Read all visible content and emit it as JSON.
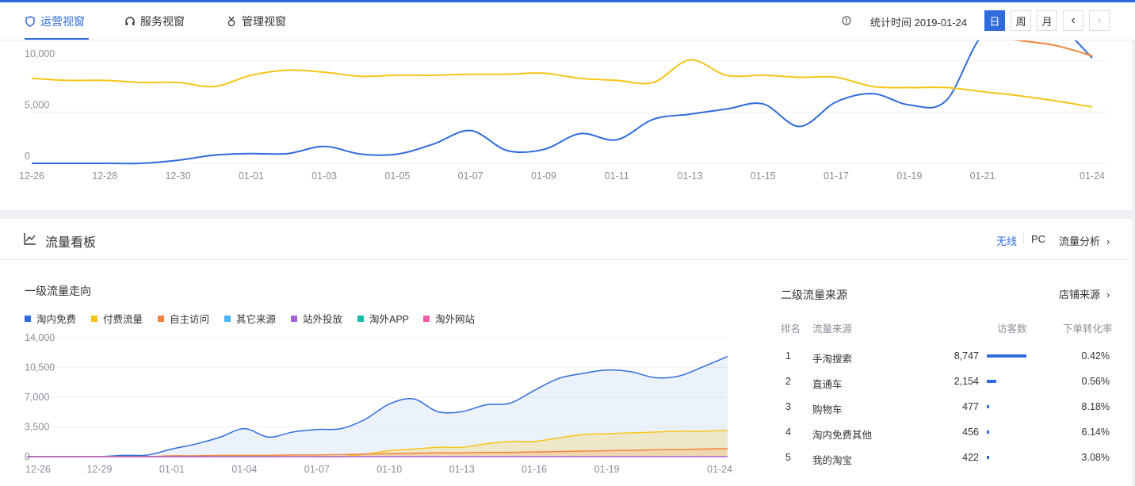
{
  "header": {
    "tabs": [
      {
        "label": "运营视窗",
        "active": true
      },
      {
        "label": "服务视窗",
        "active": false
      },
      {
        "label": "管理视窗",
        "active": false
      }
    ],
    "stat_time": "统计时间 2019-01-24",
    "period_buttons": [
      "日",
      "周",
      "月"
    ],
    "active_period": "日",
    "prev_label": "‹",
    "next_label": "›"
  },
  "top_chart": {
    "y_ticks": [
      "10,000",
      "5,000",
      "0"
    ],
    "x_ticks": [
      "12-26",
      "12-28",
      "12-30",
      "01-01",
      "01-03",
      "01-05",
      "01-07",
      "01-09",
      "01-11",
      "01-13",
      "01-15",
      "01-17",
      "01-19",
      "01-21",
      "01-24"
    ]
  },
  "panel": {
    "title": "流量看板",
    "modes": [
      "无线",
      "PC"
    ],
    "active_mode": "无线",
    "flow_link": "流量分析"
  },
  "level1": {
    "title": "一级流量走向",
    "legend": [
      {
        "name": "淘内免费",
        "color": "#2f6bdc"
      },
      {
        "name": "付费流量",
        "color": "#f5c518"
      },
      {
        "name": "自主访问",
        "color": "#f4843d"
      },
      {
        "name": "其它来源",
        "color": "#4db3f4"
      },
      {
        "name": "站外投放",
        "color": "#a862db"
      },
      {
        "name": "淘外APP",
        "color": "#17bfa8"
      },
      {
        "name": "淘外网站",
        "color": "#f05ea8"
      }
    ],
    "y_ticks": [
      "14,000",
      "10,500",
      "7,000",
      "3,500",
      "0"
    ],
    "x_ticks": [
      "12-26",
      "12-29",
      "01-01",
      "01-04",
      "01-07",
      "01-10",
      "01-13",
      "01-16",
      "01-19",
      "01-24"
    ]
  },
  "level2": {
    "title": "二级流量来源",
    "shop_source": "店铺来源",
    "headers": {
      "rank": "排名",
      "source": "流量来源",
      "visitors": "访客数",
      "conversion": "下单转化率"
    },
    "rows": [
      {
        "rank": "1",
        "source": "手淘搜索",
        "visitors": "8,747",
        "share": 1.0,
        "conversion": "0.42%"
      },
      {
        "rank": "2",
        "source": "直通车",
        "visitors": "2,154",
        "share": 0.246,
        "conversion": "0.56%"
      },
      {
        "rank": "3",
        "source": "购物车",
        "visitors": "477",
        "share": 0.055,
        "conversion": "8.18%"
      },
      {
        "rank": "4",
        "source": "淘内免费其他",
        "visitors": "456",
        "share": 0.052,
        "conversion": "6.14%"
      },
      {
        "rank": "5",
        "source": "我的淘宝",
        "visitors": "422",
        "share": 0.048,
        "conversion": "3.08%"
      }
    ]
  },
  "chart_data": [
    {
      "type": "line",
      "x": [
        "12-26",
        "12-27",
        "12-28",
        "12-29",
        "12-30",
        "12-31",
        "01-01",
        "01-02",
        "01-03",
        "01-04",
        "01-05",
        "01-06",
        "01-07",
        "01-08",
        "01-09",
        "01-10",
        "01-11",
        "01-12",
        "01-13",
        "01-14",
        "01-15",
        "01-16",
        "01-17",
        "01-18",
        "01-19",
        "01-20",
        "01-21",
        "01-22",
        "01-23",
        "01-24"
      ],
      "ylim": [
        0,
        12000
      ],
      "series": [
        {
          "color": "#2f6bdc",
          "values": [
            0,
            0,
            0,
            0,
            300,
            800,
            950,
            950,
            1650,
            900,
            900,
            1900,
            3200,
            1250,
            1350,
            2900,
            2300,
            4300,
            4800,
            5300,
            5800,
            3600,
            6000,
            6800,
            5700,
            6100,
            12500,
            12900,
            13500,
            10300
          ]
        },
        {
          "color": "#f5c518",
          "values": [
            8300,
            8100,
            8100,
            7900,
            7900,
            7500,
            8600,
            9100,
            8900,
            8500,
            8600,
            8600,
            8700,
            8700,
            8800,
            8300,
            8100,
            7900,
            10100,
            8600,
            8600,
            8400,
            8400,
            7500,
            7400,
            7400,
            7000,
            6600,
            6100,
            5500
          ]
        },
        {
          "color": "#f4843d",
          "values": [
            null,
            null,
            null,
            null,
            null,
            null,
            null,
            null,
            null,
            null,
            null,
            null,
            null,
            null,
            null,
            null,
            null,
            null,
            null,
            null,
            null,
            null,
            null,
            14000,
            13000,
            13000,
            12500,
            12000,
            11500,
            10500
          ]
        }
      ]
    },
    {
      "type": "area",
      "x": [
        "12-26",
        "12-27",
        "12-28",
        "12-29",
        "12-30",
        "12-31",
        "01-01",
        "01-02",
        "01-03",
        "01-04",
        "01-05",
        "01-06",
        "01-07",
        "01-08",
        "01-09",
        "01-10",
        "01-11",
        "01-12",
        "01-13",
        "01-14",
        "01-15",
        "01-16",
        "01-17",
        "01-18",
        "01-19",
        "01-20",
        "01-21",
        "01-22",
        "01-23",
        "01-24"
      ],
      "ylim": [
        0,
        14000
      ],
      "series": [
        {
          "name": "淘内免费",
          "color": "#2f6bdc",
          "values": [
            0,
            0,
            0,
            0,
            150,
            200,
            900,
            1500,
            2300,
            3300,
            2300,
            2900,
            3200,
            3300,
            4400,
            6200,
            6800,
            5300,
            5300,
            6100,
            6300,
            7800,
            9200,
            9800,
            10200,
            10000,
            9300,
            9500,
            10600,
            11800
          ]
        },
        {
          "name": "付费流量",
          "color": "#f5c518",
          "values": [
            0,
            0,
            0,
            0,
            0,
            0,
            0,
            0,
            0,
            0,
            0,
            0,
            0,
            0,
            300,
            700,
            900,
            1100,
            1100,
            1500,
            1800,
            1800,
            2200,
            2600,
            2700,
            2800,
            2900,
            3000,
            3000,
            3100
          ]
        },
        {
          "name": "自主访问",
          "color": "#f4843d",
          "values": [
            0,
            0,
            0,
            0,
            0,
            0,
            100,
            100,
            150,
            150,
            150,
            200,
            200,
            250,
            300,
            350,
            400,
            450,
            450,
            500,
            500,
            550,
            600,
            650,
            700,
            750,
            800,
            850,
            900,
            950
          ]
        },
        {
          "name": "站外投放",
          "color": "#a862db",
          "values": [
            0,
            0,
            0,
            0,
            0,
            0,
            0,
            0,
            0,
            0,
            0,
            0,
            0,
            0,
            0,
            0,
            0,
            0,
            0,
            0,
            0,
            0,
            0,
            0,
            0,
            0,
            0,
            0,
            0,
            0
          ]
        }
      ]
    }
  ]
}
